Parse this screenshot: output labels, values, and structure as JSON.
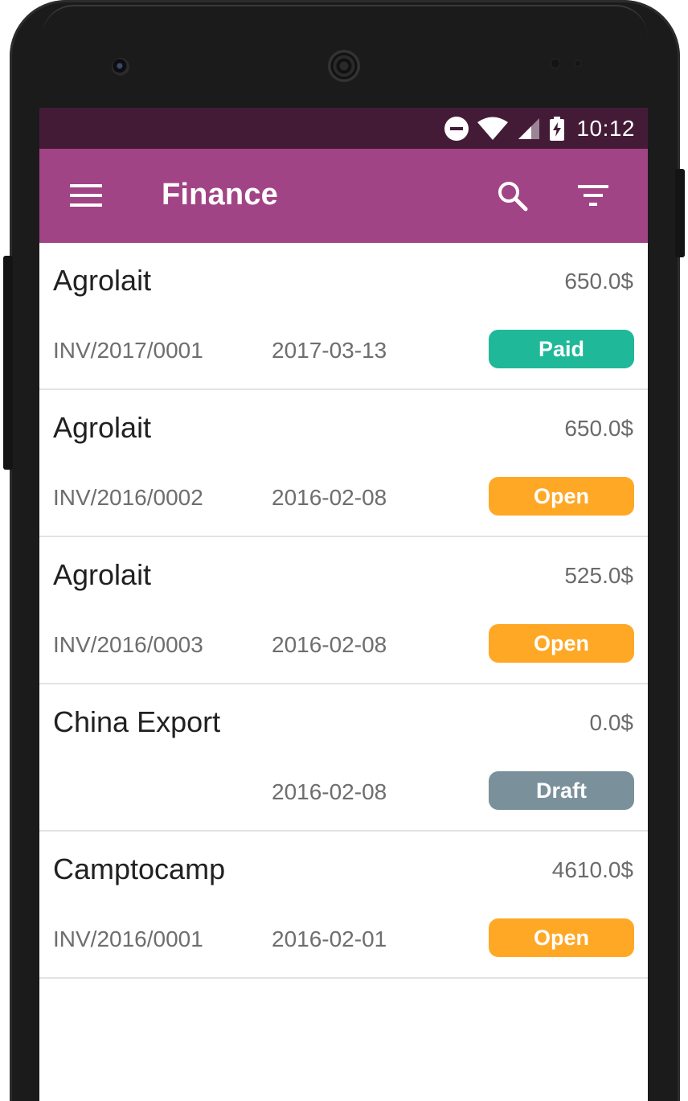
{
  "statusbar": {
    "time": "10:12",
    "icons": [
      "do-not-disturb-icon",
      "wifi-icon",
      "signal-icon",
      "battery-charging-icon"
    ]
  },
  "appbar": {
    "title": "Finance",
    "background": "#a14485",
    "actions": [
      "menu-icon",
      "search-icon",
      "filter-icon"
    ]
  },
  "colors": {
    "statusbar": "#441b37",
    "paid": "#1fb899",
    "open": "#ffa826",
    "draft": "#7a919b"
  },
  "invoices": [
    {
      "partner": "Agrolait",
      "amount": "650.0$",
      "ref": "INV/2017/0001",
      "date": "2017-03-13",
      "status": "Paid",
      "status_color": "#1fb899"
    },
    {
      "partner": "Agrolait",
      "amount": "650.0$",
      "ref": "INV/2016/0002",
      "date": "2016-02-08",
      "status": "Open",
      "status_color": "#ffa826"
    },
    {
      "partner": "Agrolait",
      "amount": "525.0$",
      "ref": "INV/2016/0003",
      "date": "2016-02-08",
      "status": "Open",
      "status_color": "#ffa826"
    },
    {
      "partner": "China Export",
      "amount": "0.0$",
      "ref": "",
      "date": "2016-02-08",
      "status": "Draft",
      "status_color": "#7a919b"
    },
    {
      "partner": "Camptocamp",
      "amount": "4610.0$",
      "ref": "INV/2016/0001",
      "date": "2016-02-01",
      "status": "Open",
      "status_color": "#ffa826"
    }
  ]
}
